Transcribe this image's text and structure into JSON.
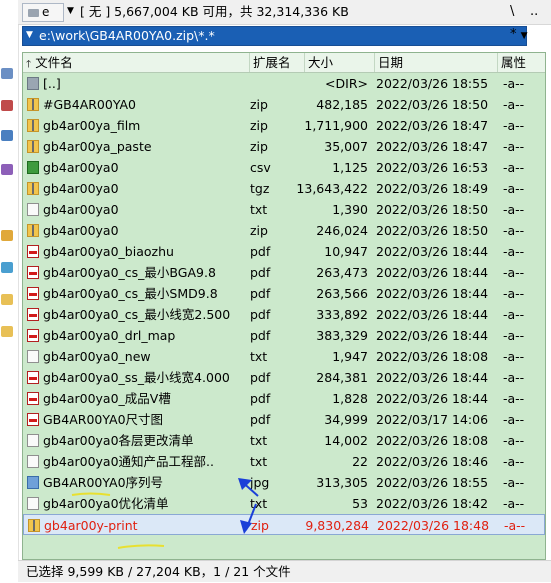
{
  "drive": {
    "letter": "e",
    "info": "[ 无 ]  5,667,004 KB 可用，共 32,314,336 KB"
  },
  "toolbar": {
    "root_button": "\\",
    "up_button": "..",
    "star_button": "*"
  },
  "path": {
    "value": "e:\\work\\GB4AR00YA0.zip\\*.*"
  },
  "columns": {
    "name": "文件名",
    "ext": "扩展名",
    "size": "大小",
    "date": "日期",
    "attr": "属性"
  },
  "files": [
    {
      "icon": "folder-up-icon",
      "type": "up",
      "name": "[..]",
      "ext": "",
      "size": "<DIR>",
      "date": "2022/03/26 18:55",
      "attr": "-a--"
    },
    {
      "icon": "zip-archive-icon",
      "type": "zip",
      "name": "#GB4AR00YA0",
      "ext": "zip",
      "size": "482,185",
      "date": "2022/03/26 18:50",
      "attr": "-a--"
    },
    {
      "icon": "zip-archive-icon",
      "type": "zip",
      "name": "gb4ar00ya_film",
      "ext": "zip",
      "size": "1,711,900",
      "date": "2022/03/26 18:47",
      "attr": "-a--"
    },
    {
      "icon": "zip-archive-icon",
      "type": "zip",
      "name": "gb4ar00ya_paste",
      "ext": "zip",
      "size": "35,007",
      "date": "2022/03/26 18:47",
      "attr": "-a--"
    },
    {
      "icon": "csv-file-icon",
      "type": "csv",
      "name": "gb4ar00ya0",
      "ext": "csv",
      "size": "1,125",
      "date": "2022/03/26 16:53",
      "attr": "-a--"
    },
    {
      "icon": "zip-archive-icon",
      "type": "zip",
      "name": "gb4ar00ya0",
      "ext": "tgz",
      "size": "13,643,422",
      "date": "2022/03/26 18:49",
      "attr": "-a--"
    },
    {
      "icon": "text-file-icon",
      "type": "txt",
      "name": "gb4ar00ya0",
      "ext": "txt",
      "size": "1,390",
      "date": "2022/03/26 18:50",
      "attr": "-a--"
    },
    {
      "icon": "zip-archive-icon",
      "type": "zip",
      "name": "gb4ar00ya0",
      "ext": "zip",
      "size": "246,024",
      "date": "2022/03/26 18:50",
      "attr": "-a--"
    },
    {
      "icon": "pdf-file-icon",
      "type": "pdf",
      "name": "gb4ar00ya0_biaozhu",
      "ext": "pdf",
      "size": "10,947",
      "date": "2022/03/26 18:44",
      "attr": "-a--"
    },
    {
      "icon": "pdf-file-icon",
      "type": "pdf",
      "name": "gb4ar00ya0_cs_最小BGA9.8",
      "ext": "pdf",
      "size": "263,473",
      "date": "2022/03/26 18:44",
      "attr": "-a--"
    },
    {
      "icon": "pdf-file-icon",
      "type": "pdf",
      "name": "gb4ar00ya0_cs_最小SMD9.8",
      "ext": "pdf",
      "size": "263,566",
      "date": "2022/03/26 18:44",
      "attr": "-a--"
    },
    {
      "icon": "pdf-file-icon",
      "type": "pdf",
      "name": "gb4ar00ya0_cs_最小线宽2.500",
      "ext": "pdf",
      "size": "333,892",
      "date": "2022/03/26 18:44",
      "attr": "-a--"
    },
    {
      "icon": "pdf-file-icon",
      "type": "pdf",
      "name": "gb4ar00ya0_drl_map",
      "ext": "pdf",
      "size": "383,329",
      "date": "2022/03/26 18:44",
      "attr": "-a--"
    },
    {
      "icon": "text-file-icon",
      "type": "txt",
      "name": "gb4ar00ya0_new",
      "ext": "txt",
      "size": "1,947",
      "date": "2022/03/26 18:08",
      "attr": "-a--"
    },
    {
      "icon": "pdf-file-icon",
      "type": "pdf",
      "name": "gb4ar00ya0_ss_最小线宽4.000",
      "ext": "pdf",
      "size": "284,381",
      "date": "2022/03/26 18:44",
      "attr": "-a--"
    },
    {
      "icon": "pdf-file-icon",
      "type": "pdf",
      "name": "gb4ar00ya0_成品V槽",
      "ext": "pdf",
      "size": "1,828",
      "date": "2022/03/26 18:44",
      "attr": "-a--"
    },
    {
      "icon": "pdf-file-icon",
      "type": "pdf",
      "name": "GB4AR00YA0尺寸图",
      "ext": "pdf",
      "size": "34,999",
      "date": "2022/03/17 14:06",
      "attr": "-a--"
    },
    {
      "icon": "text-file-icon",
      "type": "txt",
      "name": "gb4ar00ya0各层更改清单",
      "ext": "txt",
      "size": "14,002",
      "date": "2022/03/26 18:08",
      "attr": "-a--"
    },
    {
      "icon": "text-file-icon",
      "type": "txt",
      "name": "gb4ar00ya0通知产品工程部..",
      "ext": "txt",
      "size": "22",
      "date": "2022/03/26 18:46",
      "attr": "-a--"
    },
    {
      "icon": "image-file-icon",
      "type": "jpg",
      "name": "GB4AR00YA0序列号",
      "ext": "jpg",
      "size": "313,305",
      "date": "2022/03/26 18:55",
      "attr": "-a--"
    },
    {
      "icon": "text-file-icon",
      "type": "txt",
      "name": "gb4ar00ya0优化清单",
      "ext": "txt",
      "size": "53",
      "date": "2022/03/26 18:42",
      "attr": "-a--"
    },
    {
      "icon": "zip-archive-icon",
      "type": "zip",
      "name": "gb4ar00y-print",
      "ext": "zip",
      "size": "9,830,284",
      "date": "2022/03/26 18:48",
      "attr": "-a--",
      "selected": true
    }
  ],
  "status": {
    "text": "已选择 9,599 KB / 27,204 KB，1 / 21 个文件"
  },
  "colors": {
    "panel_bg": "#cce9cc",
    "path_bg": "#1a5fb4",
    "selected_text": "#e02010",
    "annotation_blue": "#1a3fd8",
    "annotation_yellow": "#e8e030"
  },
  "annotations": [
    {
      "type": "arrow",
      "color": "blue"
    },
    {
      "type": "arrow",
      "color": "blue"
    },
    {
      "type": "underline",
      "color": "yellow"
    },
    {
      "type": "underline",
      "color": "yellow"
    }
  ]
}
